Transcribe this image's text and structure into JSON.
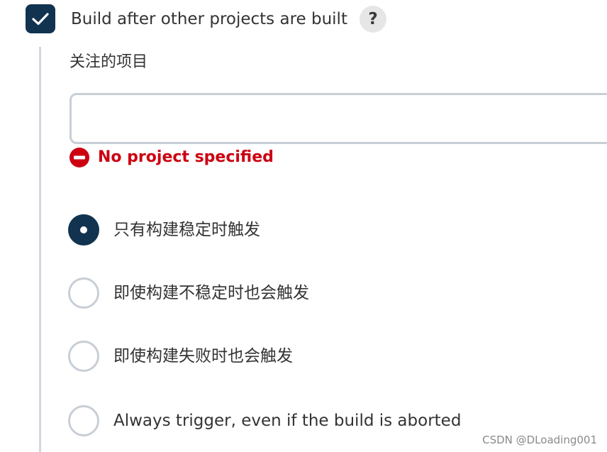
{
  "trigger": {
    "checkbox_label": "Build after other projects are built",
    "checked": true,
    "help_label": "?"
  },
  "projects_field": {
    "label": "关注的项目",
    "value": "",
    "placeholder": ""
  },
  "error": {
    "message": "No project specified",
    "icon": "error-circle-icon",
    "color": "#cc0011"
  },
  "options": [
    {
      "label": "只有构建稳定时触发",
      "selected": true
    },
    {
      "label": "即使构建不稳定时也会触发",
      "selected": false
    },
    {
      "label": "即使构建失败时也会触发",
      "selected": false
    },
    {
      "label": "Always trigger, even if the build is aborted",
      "selected": false
    }
  ],
  "watermark": "CSDN @DLoading001",
  "colors": {
    "accent": "#113350",
    "border": "#c8ced6",
    "error": "#cc0011",
    "text": "#333333"
  }
}
